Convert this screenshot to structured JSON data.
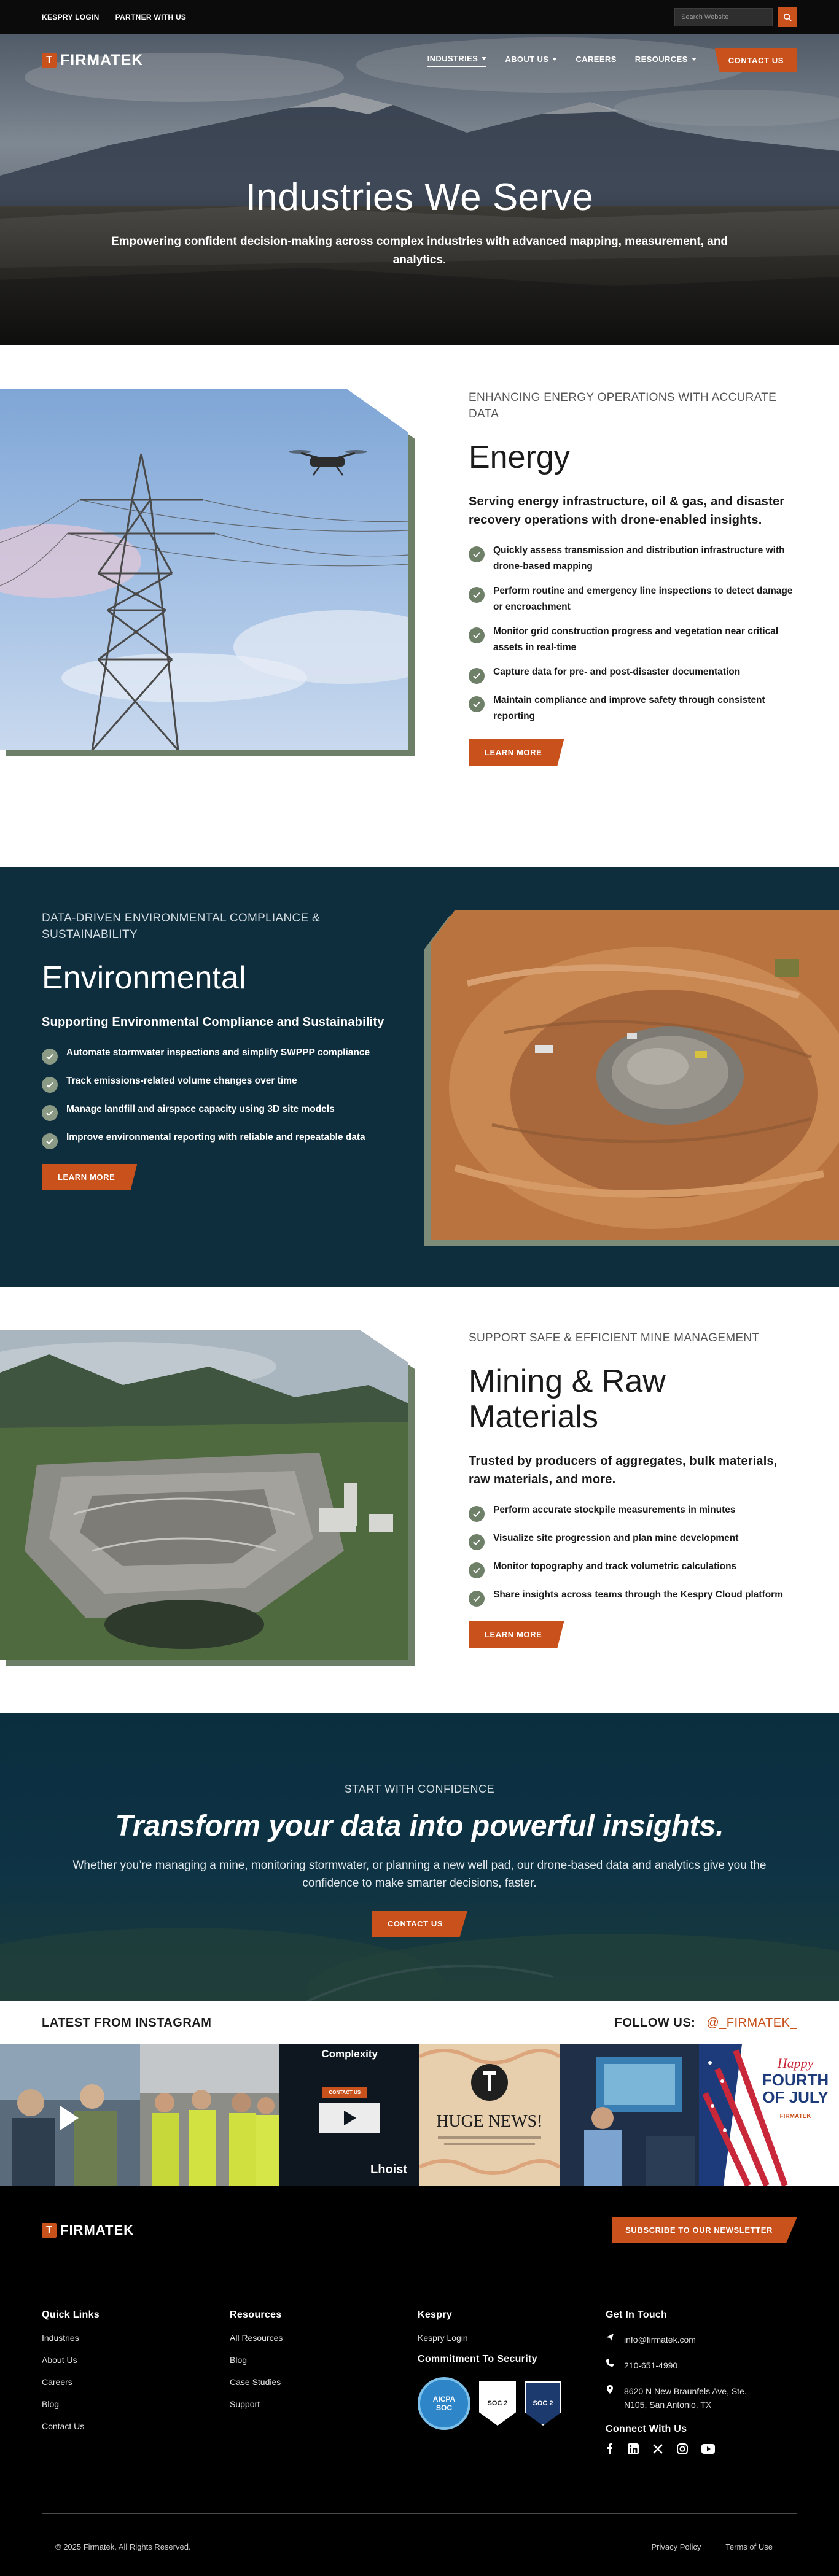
{
  "topbar": {
    "links": [
      "KESPRY LOGIN",
      "PARTNER WITH US"
    ],
    "search_placeholder": "Search Website"
  },
  "nav": {
    "logo_mark": "T",
    "logo_text": "FIRMATEK",
    "items": [
      "INDUSTRIES",
      "ABOUT US",
      "CAREERS",
      "RESOURCES"
    ],
    "contact_label": "CONTACT US"
  },
  "hero": {
    "title": "Industries We Serve",
    "subtitle": "Empowering confident decision-making across complex industries with advanced mapping, measurement, and analytics."
  },
  "energy": {
    "eyebrow": "ENHANCING ENERGY OPERATIONS WITH ACCURATE DATA",
    "title": "Energy",
    "lead": "Serving energy infrastructure, oil & gas, and disaster recovery operations with drone-enabled insights.",
    "bullets": [
      "Quickly assess transmission and distribution infrastructure with drone-based mapping",
      "Perform routine and emergency line inspections to detect damage or encroachment",
      "Monitor grid construction progress and vegetation near critical assets in real-time",
      "Capture data for pre- and post-disaster documentation",
      "Maintain compliance and improve safety through consistent reporting"
    ],
    "button": "LEARN MORE"
  },
  "environmental": {
    "eyebrow": "DATA-DRIVEN ENVIRONMENTAL COMPLIANCE & SUSTAINABILITY",
    "title": "Environmental",
    "lead": "Supporting Environmental Compliance and Sustainability",
    "bullets": [
      "Automate stormwater inspections and simplify SWPPP compliance",
      "Track emissions-related volume changes over time",
      "Manage landfill and airspace capacity using 3D site models",
      "Improve environmental reporting with reliable and repeatable data"
    ],
    "button": "LEARN MORE"
  },
  "mining": {
    "eyebrow": "SUPPORT SAFE & EFFICIENT MINE MANAGEMENT",
    "title": "Mining & Raw Materials",
    "lead": "Trusted by producers of aggregates, bulk materials, raw materials, and more.",
    "bullets": [
      "Perform accurate stockpile measurements in minutes",
      "Visualize site progression and plan mine development",
      "Monitor topography and track volumetric calculations",
      "Share insights across teams through the Kespry Cloud platform"
    ],
    "button": "LEARN MORE"
  },
  "cta": {
    "eyebrow": "START WITH CONFIDENCE",
    "title": "Transform your data into powerful insights.",
    "body": "Whether you’re managing a mine, monitoring stormwater, or planning a new well pad, our drone-based data and analytics give you the confidence to make smarter decisions, faster.",
    "button": "CONTACT US"
  },
  "instagram": {
    "title": "LATEST FROM INSTAGRAM",
    "follow_label": "FOLLOW US:",
    "handle": "@_FIRMATEK_",
    "tile3_heading": "Complexity",
    "tile3_button": "CONTACT US",
    "tile3_brand": "Lhoist",
    "tile4_text": "HUGE NEWS!",
    "tile6_line1": "Happy",
    "tile6_line2": "FOURTH",
    "tile6_line3": "OF JULY",
    "tile6_brand": "FIRMATEK"
  },
  "footer": {
    "logo_text": "FIRMATEK",
    "newsletter_button": "SUBSCRIBE TO OUR NEWSLETTER",
    "quick_links": {
      "heading": "Quick Links",
      "items": [
        "Industries",
        "About Us",
        "Careers",
        "Blog",
        "Contact Us"
      ]
    },
    "resources": {
      "heading": "Resources",
      "items": [
        "All Resources",
        "Blog",
        "Case Studies",
        "Support"
      ]
    },
    "kespry": {
      "heading": "Kespry",
      "login": "Kespry Login",
      "security_heading": "Commitment To Security",
      "badge_aicpa": "AICPA SOC",
      "badge_soc2": "SOC 2",
      "badge_soc2b": "SOC 2"
    },
    "contact": {
      "heading": "Get In Touch",
      "email": "info@firmatek.com",
      "phone": "210-651-4990",
      "address_line1": "8620 N New Braunfels Ave, Ste.",
      "address_line2": "N105, San Antonio, TX",
      "connect_heading": "Connect With Us"
    },
    "copyright": "© 2025 Firmatek. All Rights Reserved.",
    "privacy": "Privacy Policy",
    "terms": "Terms of Use"
  },
  "colors": {
    "accent": "#c8511c",
    "dark_teal": "#0e2d3d",
    "check_green": "#6f8069"
  }
}
